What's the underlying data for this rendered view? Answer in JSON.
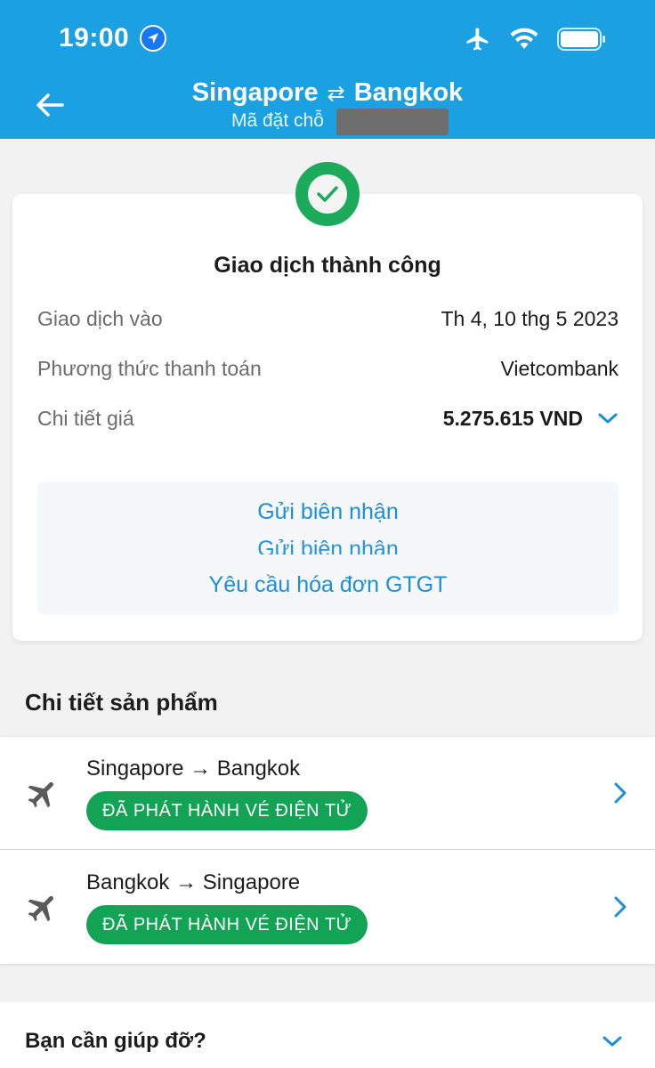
{
  "status_bar": {
    "time": "19:00",
    "icons": [
      "location-arrow-icon",
      "airplane-mode-icon",
      "wifi-icon",
      "battery-icon"
    ]
  },
  "header": {
    "origin": "Singapore",
    "swap_glyph": "⇄",
    "destination": "Bangkok",
    "booking_code_label": "Mã đặt chỗ",
    "background_color": "#1ba0e2"
  },
  "transaction": {
    "title": "Giao dịch thành công",
    "rows": [
      {
        "label": "Giao dịch vào",
        "value": "Th 4, 10 thg 5 2023"
      },
      {
        "label": "Phương thức thanh toán",
        "value": "Vietcombank"
      },
      {
        "label": "Chi tiết giá",
        "value": "5.275.615 VND"
      }
    ],
    "send_receipt": "Gửi biên nhận",
    "request_invoice": "Yêu cầu hóa đơn GTGT",
    "success_color": "#1bab5b",
    "link_color": "#1b8fd8"
  },
  "products": {
    "section_title": "Chi tiết sản phẩm",
    "items": [
      {
        "route": "Singapore → Bangkok",
        "status": "ĐÃ PHÁT HÀNH VÉ ĐIỆN TỬ"
      },
      {
        "route": "Bangkok → Singapore",
        "status": "ĐÃ PHÁT HÀNH VÉ ĐIỆN TỬ"
      }
    ],
    "badge_color": "#12a454"
  },
  "help": {
    "title": "Bạn cần giúp đỡ?"
  }
}
